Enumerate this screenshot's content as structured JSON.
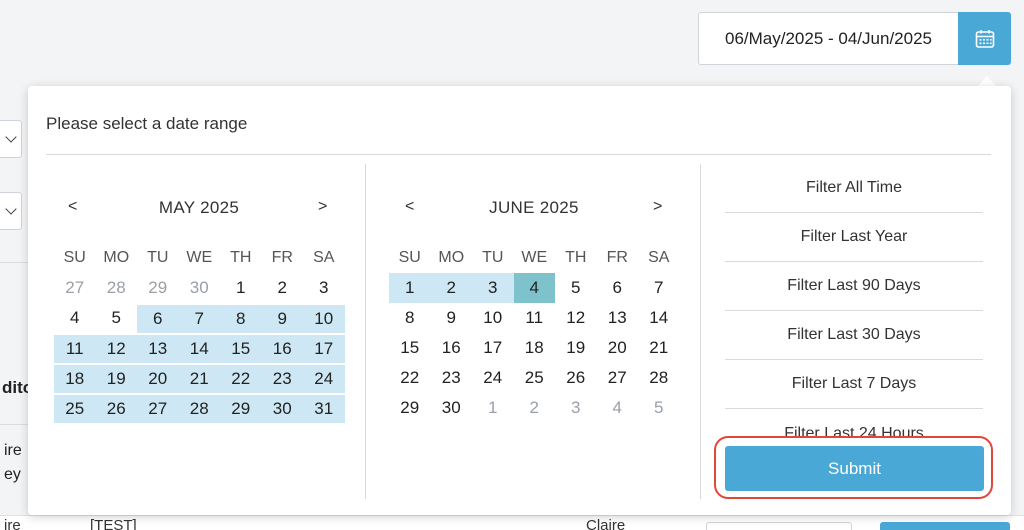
{
  "date_range": {
    "value": "06/May/2025 - 04/Jun/2025"
  },
  "popup": {
    "title": "Please select a date range"
  },
  "background": {
    "fragment_1": "dito",
    "fragment_2a": "ire",
    "fragment_2b": "ey",
    "bottom_1": "ire",
    "bottom_2": "[TEST]",
    "bottom_3": "Claire"
  },
  "calendar_left": {
    "prev": "<",
    "next": ">",
    "title": "MAY 2025",
    "days_of_week": [
      "SU",
      "MO",
      "TU",
      "WE",
      "TH",
      "FR",
      "SA"
    ],
    "weeks": [
      [
        "27",
        "28",
        "29",
        "30",
        "1",
        "2",
        "3"
      ],
      [
        "4",
        "5",
        "6",
        "7",
        "8",
        "9",
        "10"
      ],
      [
        "11",
        "12",
        "13",
        "14",
        "15",
        "16",
        "17"
      ],
      [
        "18",
        "19",
        "20",
        "21",
        "22",
        "23",
        "24"
      ],
      [
        "25",
        "26",
        "27",
        "28",
        "29",
        "30",
        "31"
      ]
    ]
  },
  "calendar_right": {
    "prev": "<",
    "next": ">",
    "title": "JUNE 2025",
    "days_of_week": [
      "SU",
      "MO",
      "TU",
      "WE",
      "TH",
      "FR",
      "SA"
    ],
    "weeks": [
      [
        "1",
        "2",
        "3",
        "4",
        "5",
        "6",
        "7"
      ],
      [
        "8",
        "9",
        "10",
        "11",
        "12",
        "13",
        "14"
      ],
      [
        "15",
        "16",
        "17",
        "18",
        "19",
        "20",
        "21"
      ],
      [
        "22",
        "23",
        "24",
        "25",
        "26",
        "27",
        "28"
      ],
      [
        "29",
        "30",
        "1",
        "2",
        "3",
        "4",
        "5"
      ]
    ]
  },
  "filters": {
    "items": [
      "Filter All Time",
      "Filter Last Year",
      "Filter Last 90 Days",
      "Filter Last 30 Days",
      "Filter Last 7 Days",
      "Filter Last 24 Hours"
    ],
    "submit": "Submit"
  },
  "colors": {
    "accent": "#4aa8d6",
    "range": "#cde8f4",
    "range_end": "#7ec3cb",
    "highlight": "#e0463a"
  }
}
